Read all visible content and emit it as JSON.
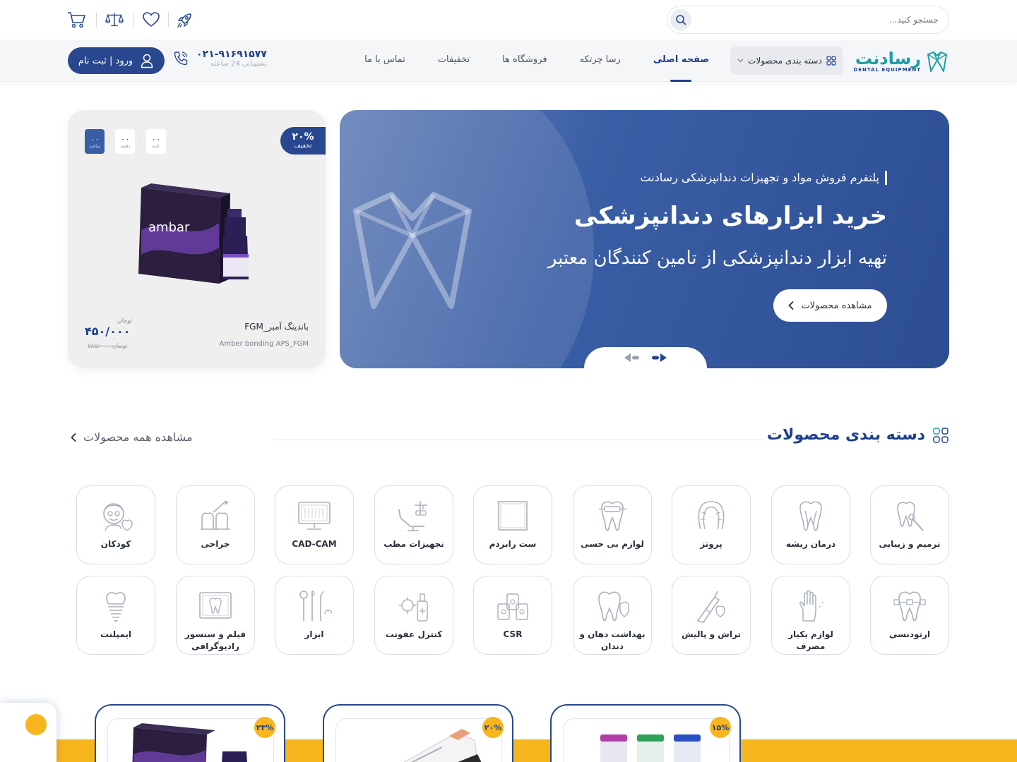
{
  "header": {
    "search_placeholder": "جستجو کنید...",
    "icons": [
      "rocket-icon",
      "heart-icon",
      "compare-scale-icon",
      "cart-icon"
    ]
  },
  "nav": {
    "logo_name": "رسادنت",
    "logo_sub": "DENTAL EQUIPMENT",
    "categories_label": "دسته بندی محصولات",
    "links": [
      "صفحه اصلی",
      "رسا چرتکه",
      "فروشگاه ها",
      "تخفیفات",
      "تماس با ما"
    ],
    "phone_number": "۰۲۱-۹۱۶۹۱۵۷۷",
    "phone_sub": "پشتیبانی 24 ساعته",
    "login_label": "ورود | ثبت نام"
  },
  "hero": {
    "subtitle": "پلتفرم فروش مواد و تجهیزات دندانپزشکی رسادنت",
    "title": "خرید ابزارهای دندانپزشکی",
    "tagline": "تهیه ابزار دندانپزشکی از تامین کنندگان معتبر",
    "cta": "مشاهده محصولات"
  },
  "deal": {
    "discount": "۲۰%",
    "discount_label": "تخفیف",
    "timer": [
      {
        "value": "۰۰",
        "label": "ثانیه"
      },
      {
        "value": "۰۰",
        "label": "دقیقه"
      },
      {
        "value": "۰۰",
        "label": "ساعت"
      }
    ],
    "product_name": "باندینگ آمبر_FGM",
    "product_name_en": "Amber bonding APS_FGM",
    "currency": "تومان",
    "price": "۴۵۰/۰۰۰",
    "old_price": "۵۸۵/۰۰۰ تومان",
    "product_brand": "ambar"
  },
  "categories": {
    "title": "دسته بندی محصولات",
    "see_all": "مشاهده همه محصولات",
    "row1": [
      "ترمیم و زیبایی",
      "درمان ریشه",
      "پروتز",
      "لوازم بی حسی",
      "ست رابردم",
      "تجهیزات مطب",
      "CAD-CAM",
      "جراحی",
      "کودکان"
    ],
    "row2": [
      "ارتودنسی",
      "لوازم یکبار مصرف",
      "تراش و پالیش",
      "بهداشت دهان و دندان",
      "CSR",
      "کنترل عفونت",
      "ابزار",
      "فیلم و سنسور رادیوگرافی",
      "ایمپلنت"
    ]
  },
  "offers": {
    "discounts": [
      "۱۵%",
      "۲۰%",
      "۲۳%"
    ]
  },
  "colors": {
    "primary": "#28478f",
    "accent": "#f7b51e",
    "teal": "#1e9ea6"
  }
}
